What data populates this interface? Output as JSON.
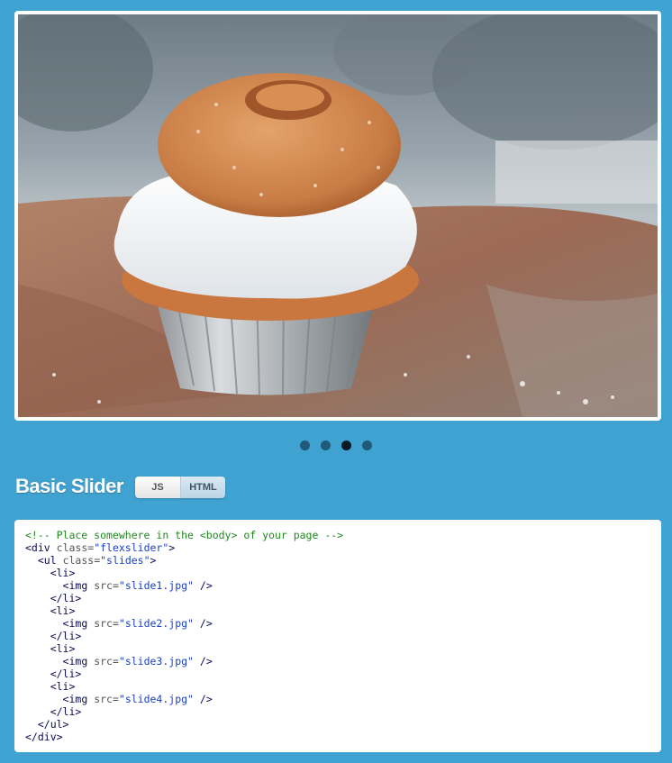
{
  "slider": {
    "image_description_icon": "cupcake-with-donut-photo",
    "pager": [
      {
        "label": "1",
        "active": false
      },
      {
        "label": "2",
        "active": false
      },
      {
        "label": "3",
        "active": true
      },
      {
        "label": "4",
        "active": false
      }
    ]
  },
  "section": {
    "title": "Basic Slider",
    "tabs": [
      "JS",
      "HTML"
    ],
    "active_tab": "HTML"
  },
  "code": {
    "comment": "<!-- Place somewhere in the <body> of your page -->",
    "div_open_tag": "<div",
    "div_attr": "class=",
    "div_val": "\"flexslider\"",
    "div_close": ">",
    "ul_open_tag": "<ul",
    "ul_attr": "class=",
    "ul_val": "\"slides\"",
    "ul_close": ">",
    "li_open": "<li>",
    "li_close": "</li>",
    "img_tag": "<img",
    "img_attr": "src=",
    "img_end": "/>",
    "slides": [
      "\"slide1.jpg\"",
      "\"slide2.jpg\"",
      "\"slide3.jpg\"",
      "\"slide4.jpg\""
    ],
    "ul_end": "</ul>",
    "div_end": "</div>"
  }
}
